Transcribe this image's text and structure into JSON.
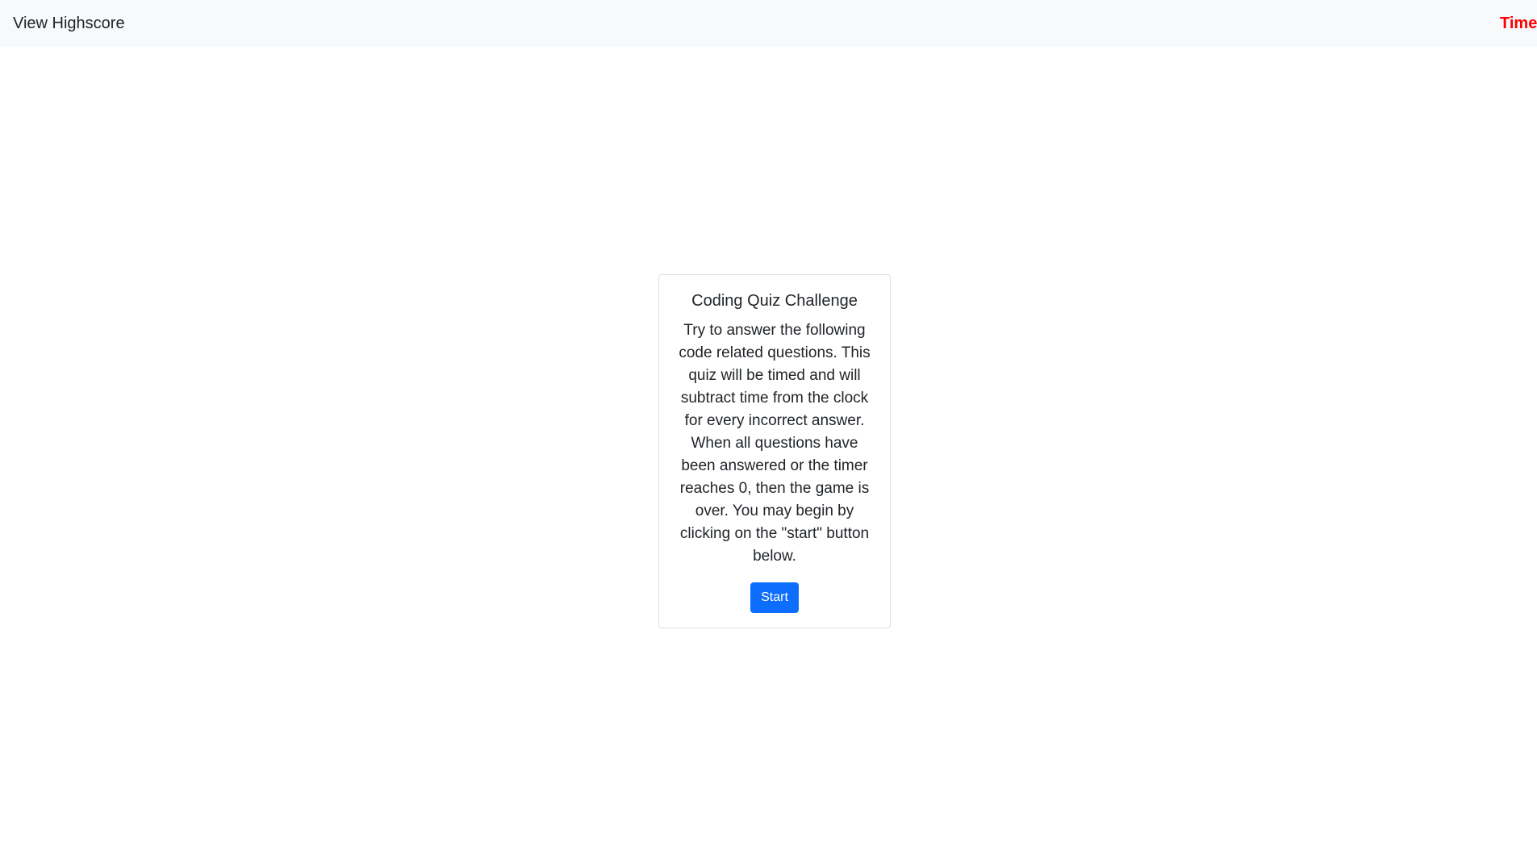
{
  "navbar": {
    "highscore_link": "View Highscore",
    "timer_label": "Time"
  },
  "card": {
    "title": "Coding Quiz Challenge",
    "text": "Try to answer the following code related questions. This quiz will be timed and will subtract time from the clock for every incorrect answer. When all questions have been answered or the timer reaches 0, then the game is over. You may begin by clicking on the \"start\" button below.",
    "start_button": "Start"
  },
  "colors": {
    "navbar_bg": "#f8f9fa",
    "timer": "#ff0000",
    "primary_button": "#0d6efd"
  }
}
